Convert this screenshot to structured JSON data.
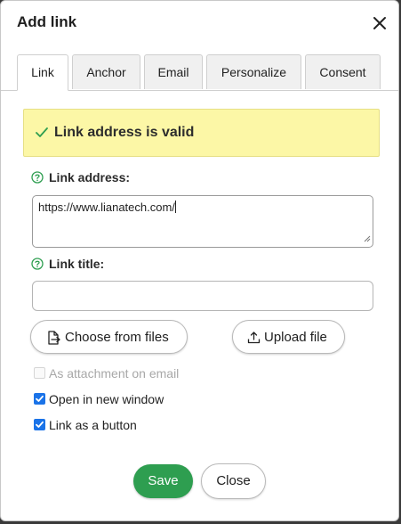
{
  "dialog": {
    "title": "Add link",
    "close_icon": "close-icon"
  },
  "tabs": [
    {
      "label": "Link",
      "active": true
    },
    {
      "label": "Anchor",
      "active": false
    },
    {
      "label": "Email",
      "active": false
    },
    {
      "label": "Personalize",
      "active": false
    },
    {
      "label": "Consent",
      "active": false
    }
  ],
  "alert": {
    "text": "Link address is valid",
    "icon": "check-icon",
    "background": "#fcf7a6",
    "icon_color": "#2e9e50"
  },
  "link_address": {
    "label": "Link address:",
    "value": "https://www.lianatech.com/",
    "help_icon": "help-icon"
  },
  "link_title": {
    "label": "Link title:",
    "value": "",
    "help_icon": "help-icon"
  },
  "buttons": {
    "choose_from_files": "Choose from files",
    "upload_file": "Upload file",
    "save": "Save",
    "close": "Close"
  },
  "options": [
    {
      "label": "As attachment on email",
      "checked": false,
      "disabled": true
    },
    {
      "label": "Open in new window",
      "checked": true,
      "disabled": false
    },
    {
      "label": "Link as a button",
      "checked": true,
      "disabled": false
    }
  ],
  "colors": {
    "primary": "#2e9e50",
    "checkbox": "#1a73e8"
  }
}
